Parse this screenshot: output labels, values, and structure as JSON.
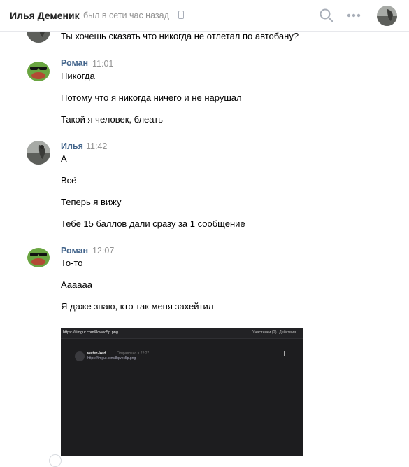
{
  "header": {
    "name": "Илья Деменик",
    "status": "был в сети час назад"
  },
  "messages": [
    {
      "lines": [
        "Ты хочешь сказать что никогда не отлетал по автобану?"
      ]
    },
    {
      "author": "Роман",
      "time": "11:01",
      "lines": [
        "Никогда",
        "Потому что я никогда ничего и не нарушал",
        "Такой я человек, блеать"
      ]
    },
    {
      "author": "Илья",
      "time": "11:42",
      "lines": [
        "А",
        "Всё",
        "Теперь я вижу",
        "Тебе 15 баллов дали сразу за 1 сообщение"
      ]
    },
    {
      "author": "Роман",
      "time": "12:07",
      "lines": [
        "То-то",
        "Аааааа",
        "Я даже знаю, кто так меня захейтил"
      ]
    }
  ],
  "attachment": {
    "url": "https://i.imgur.com/8qwec5p.png",
    "members": "Участники (2)",
    "actions": "Действия",
    "user": "water-lord",
    "timestamp": "Отправлено в 22:27",
    "link": "https://imgur.com/8qwec5p.png"
  }
}
